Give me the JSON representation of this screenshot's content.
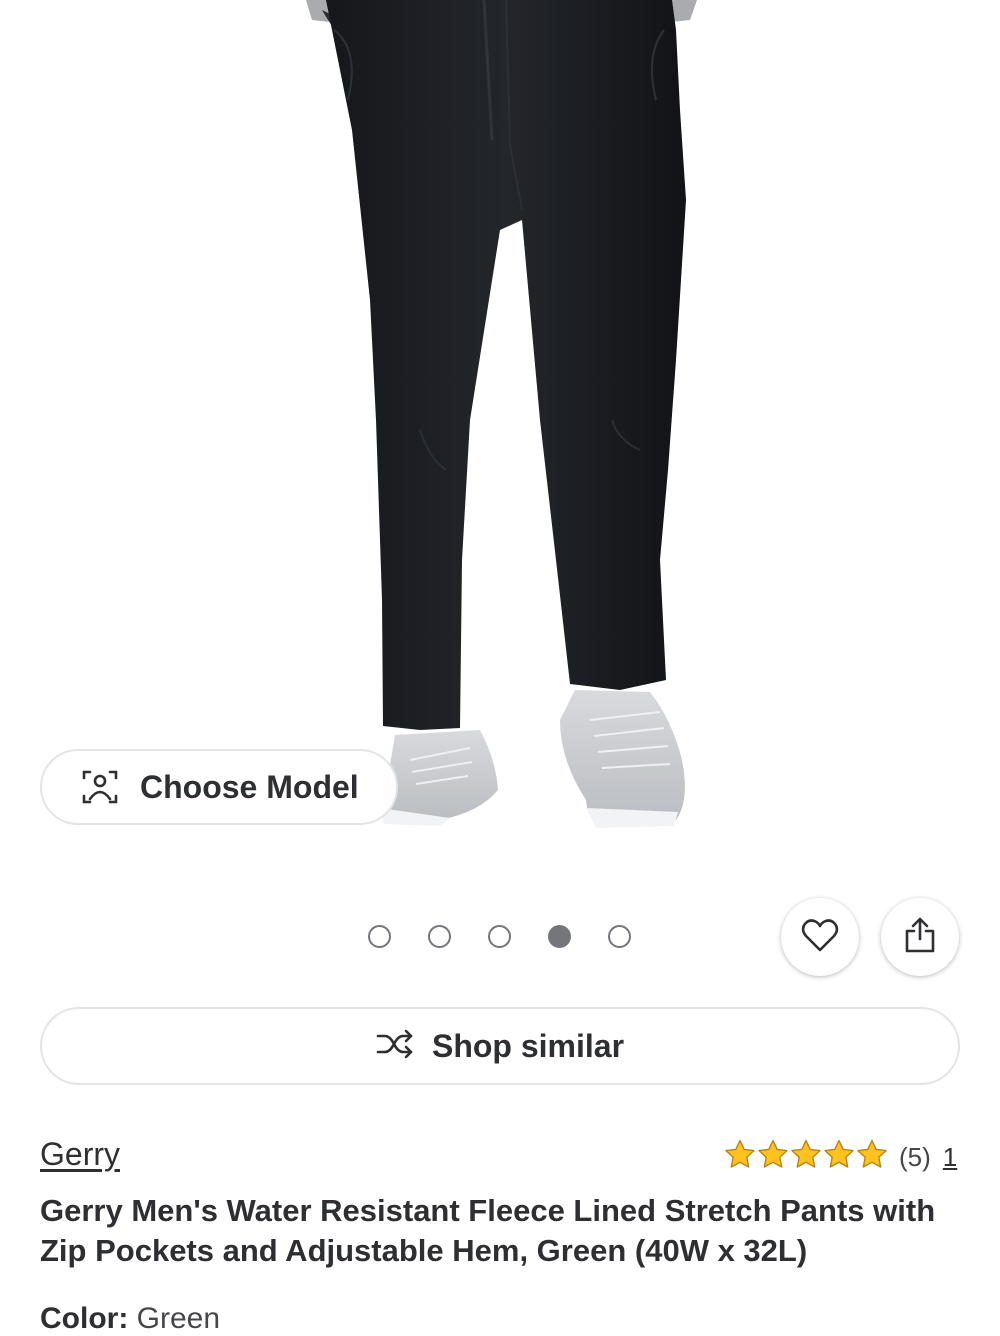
{
  "choose_model": {
    "label": "Choose Model",
    "icon": "person-scan-icon"
  },
  "gallery": {
    "dot_count": 5,
    "active_index": 3
  },
  "actions": {
    "favorite_icon": "heart-icon",
    "share_icon": "share-icon"
  },
  "shop_similar": {
    "label": "Shop similar",
    "icon": "shuffle-icon"
  },
  "product": {
    "brand": "Gerry",
    "rating": {
      "stars": 5,
      "count_text": "(5)",
      "link_text": "1"
    },
    "title": "Gerry Men's Water Resistant Fleece Lined Stretch Pants with Zip Pockets and Adjustable Hem, Green (40W x 32L)",
    "color_label": "Color:",
    "color_value": "Green"
  },
  "colors": {
    "text": "#2e2f32",
    "star": "#ffc220",
    "border": "#e3e4e5",
    "dot": "#74767c"
  }
}
